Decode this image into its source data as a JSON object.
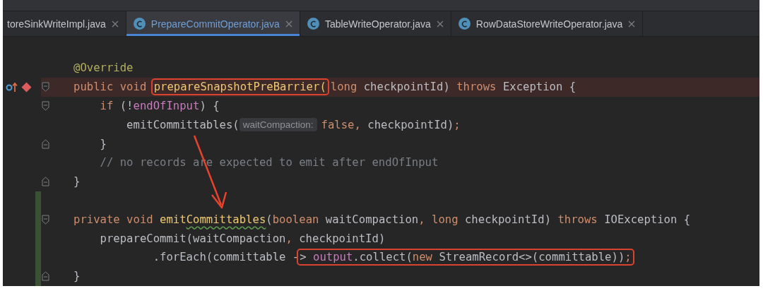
{
  "tabs": [
    {
      "label": "toreSinkWriteImpl.java",
      "selected": false,
      "icon": false
    },
    {
      "label": "PrepareCommitOperator.java",
      "selected": true,
      "icon": true
    },
    {
      "label": "TableWriteOperator.java",
      "selected": false,
      "icon": true
    },
    {
      "label": "RowDataStoreWriteOperator.java",
      "selected": false,
      "icon": true
    }
  ],
  "lines": [
    {
      "fold_start": false,
      "fold_end": false,
      "breakpoint": false,
      "changed": false,
      "segments": [
        {
          "boxed": false,
          "tokens": [
            {
              "kind": "annot",
              "text": "@Override"
            }
          ]
        }
      ]
    },
    {
      "fold_start": true,
      "fold_end": false,
      "breakpoint": true,
      "changed": false,
      "segments": [
        {
          "boxed": false,
          "tokens": [
            {
              "kind": "kw",
              "text": "public void "
            }
          ]
        },
        {
          "boxed": true,
          "tokens": [
            {
              "kind": "decl",
              "text": "prepareSnapshotPreBarrier("
            }
          ]
        },
        {
          "boxed": false,
          "tokens": [
            {
              "kind": "kw",
              "text": "long "
            },
            {
              "kind": "plain",
              "text": "checkpointId) "
            },
            {
              "kind": "kw",
              "text": "throws "
            },
            {
              "kind": "plain",
              "text": "Exception {"
            }
          ]
        }
      ]
    },
    {
      "fold_start": true,
      "fold_end": false,
      "breakpoint": false,
      "changed": false,
      "segments": [
        {
          "boxed": false,
          "tokens": [
            {
              "kind": "kw",
              "text": "    if "
            },
            {
              "kind": "plain",
              "text": "(!"
            },
            {
              "kind": "field",
              "text": "endOfInput"
            },
            {
              "kind": "plain",
              "text": ") {"
            }
          ]
        }
      ]
    },
    {
      "fold_start": false,
      "fold_end": false,
      "breakpoint": false,
      "changed": false,
      "segments": [
        {
          "boxed": false,
          "tokens": [
            {
              "kind": "plain",
              "text": "        emitCommittables("
            },
            {
              "kind": "hint",
              "text": "waitCompaction:"
            },
            {
              "kind": "kw",
              "text": "false"
            },
            {
              "kind": "punct",
              "text": ", "
            },
            {
              "kind": "plain",
              "text": "checkpointId)"
            },
            {
              "kind": "punct",
              "text": ";"
            }
          ]
        }
      ]
    },
    {
      "fold_start": false,
      "fold_end": true,
      "breakpoint": false,
      "changed": false,
      "segments": [
        {
          "boxed": false,
          "tokens": [
            {
              "kind": "plain",
              "text": "    }"
            }
          ]
        }
      ]
    },
    {
      "fold_start": false,
      "fold_end": false,
      "breakpoint": false,
      "changed": false,
      "segments": [
        {
          "boxed": false,
          "tokens": [
            {
              "kind": "comment",
              "text": "    // no records are expected to emit after endOfInput"
            }
          ]
        }
      ]
    },
    {
      "fold_start": false,
      "fold_end": true,
      "breakpoint": false,
      "changed": false,
      "segments": [
        {
          "boxed": false,
          "tokens": [
            {
              "kind": "plain",
              "text": "}"
            }
          ]
        }
      ]
    },
    {
      "fold_start": false,
      "fold_end": false,
      "breakpoint": false,
      "changed": true
    },
    {
      "fold_start": true,
      "fold_end": false,
      "breakpoint": false,
      "changed": true,
      "segments": [
        {
          "boxed": false,
          "tokens": [
            {
              "kind": "kw",
              "text": "private void "
            },
            {
              "kind": "decl",
              "text": "emit"
            },
            {
              "kind": "decl",
              "text": "Committables",
              "squiggle": true
            },
            {
              "kind": "plain",
              "text": "("
            },
            {
              "kind": "kw",
              "text": "boolean "
            },
            {
              "kind": "plain",
              "text": "waitCompaction"
            },
            {
              "kind": "punct",
              "text": ", "
            },
            {
              "kind": "kw",
              "text": "long "
            },
            {
              "kind": "plain",
              "text": "checkpointId) "
            },
            {
              "kind": "kw",
              "text": "throws "
            },
            {
              "kind": "plain",
              "text": "IOException {"
            }
          ]
        }
      ]
    },
    {
      "fold_start": false,
      "fold_end": false,
      "breakpoint": false,
      "changed": true,
      "segments": [
        {
          "boxed": false,
          "tokens": [
            {
              "kind": "plain",
              "text": "    prepareCommit(waitCompaction"
            },
            {
              "kind": "punct",
              "text": ", "
            },
            {
              "kind": "plain",
              "text": "checkpointId)"
            }
          ]
        }
      ]
    },
    {
      "fold_start": false,
      "fold_end": false,
      "breakpoint": false,
      "changed": true,
      "segments": [
        {
          "boxed": false,
          "tokens": [
            {
              "kind": "plain",
              "text": "            .forEach(committable -"
            }
          ]
        },
        {
          "boxed": true,
          "tokens": [
            {
              "kind": "plain",
              "text": "> "
            },
            {
              "kind": "field",
              "text": "output"
            },
            {
              "kind": "plain",
              "text": ".collect("
            },
            {
              "kind": "kw",
              "text": "new "
            },
            {
              "kind": "plain",
              "text": "StreamRecord<>(committable))"
            },
            {
              "kind": "punct",
              "text": ";"
            }
          ]
        }
      ]
    },
    {
      "fold_start": false,
      "fold_end": true,
      "breakpoint": false,
      "changed": true,
      "segments": [
        {
          "boxed": false,
          "tokens": [
            {
              "kind": "plain",
              "text": "}"
            }
          ]
        }
      ]
    }
  ]
}
